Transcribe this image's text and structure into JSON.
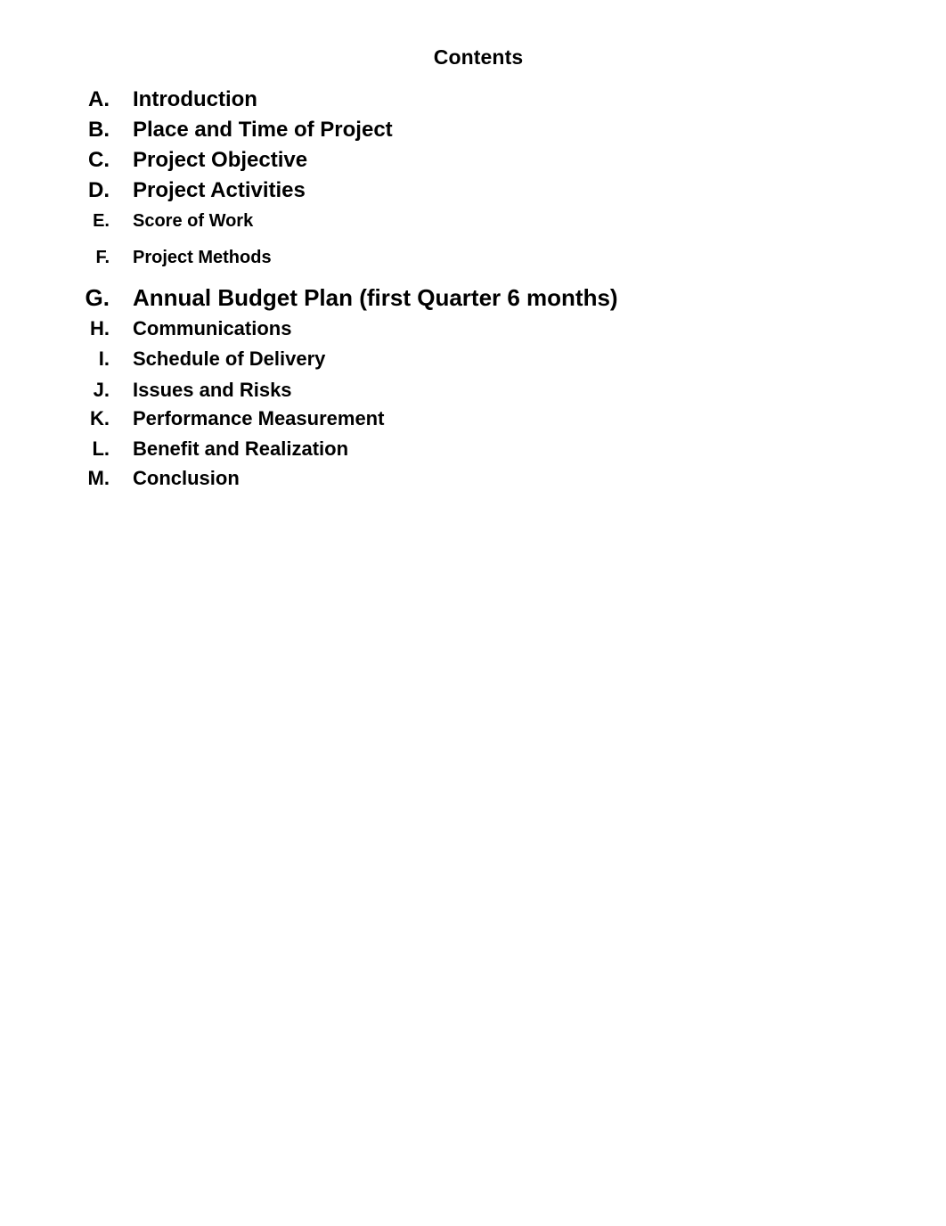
{
  "document": {
    "title": "Contents",
    "background_color": "#ffffff",
    "text_color": "#000000"
  },
  "contents": {
    "heading": "Contents",
    "items": [
      {
        "marker": "A.",
        "label": "Introduction"
      },
      {
        "marker": "B.",
        "label": "Place and Time of Project"
      },
      {
        "marker": "C.",
        "label": "Project Objective"
      },
      {
        "marker": "D.",
        "label": "Project Activities"
      },
      {
        "marker": "E.",
        "label": "Score of Work"
      },
      {
        "marker": "F.",
        "label": "Project Methods"
      },
      {
        "marker": "G.",
        "label": "Annual Budget Plan (first Quarter 6 months)"
      },
      {
        "marker": "H.",
        "label": "Communications"
      },
      {
        "marker": "I.",
        "label": "Schedule of Delivery"
      },
      {
        "marker": "J.",
        "label": "Issues and Risks"
      },
      {
        "marker": "K.",
        "label": "Performance Measurement"
      },
      {
        "marker": "L.",
        "label": "Benefit and Realization"
      },
      {
        "marker": "M.",
        "label": "Conclusion"
      }
    ]
  }
}
